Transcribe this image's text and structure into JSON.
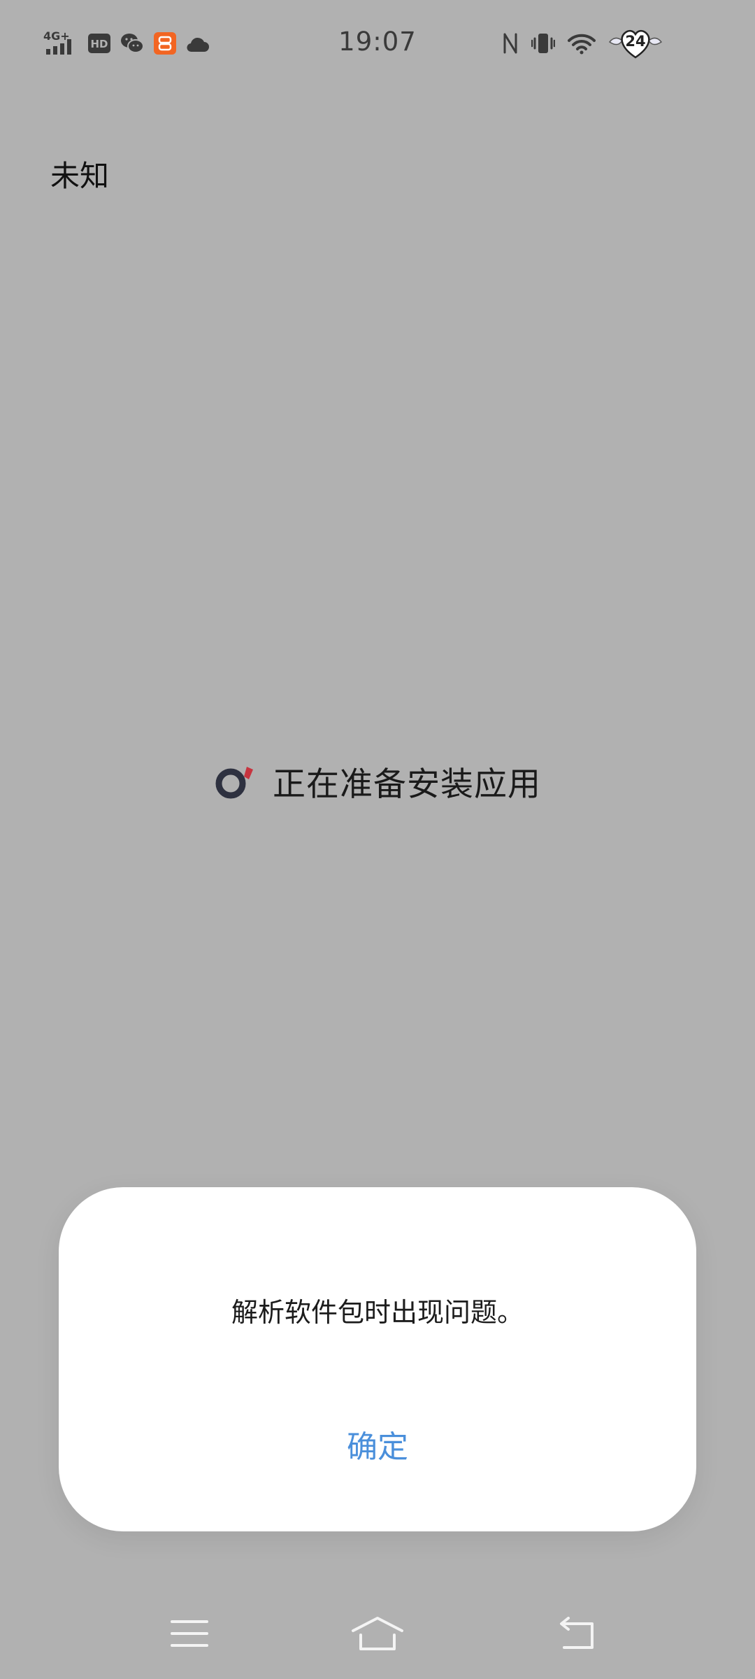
{
  "status_bar": {
    "time": "19:07",
    "network_label": "4G+",
    "hd_label": "HD",
    "badge_count": "24",
    "left_icons": [
      "signal-4g-icon",
      "hd-icon",
      "wechat-icon",
      "app-notification-icon",
      "cloud-icon"
    ],
    "right_icons": [
      "nfc-icon",
      "vibrate-icon",
      "wifi-icon",
      "heart-badge-icon"
    ]
  },
  "app": {
    "name": "未知",
    "progress_text": "正在准备安装应用"
  },
  "dialog": {
    "message": "解析软件包时出现问题。",
    "confirm_label": "确定"
  },
  "nav": {
    "icons": [
      "menu-icon",
      "home-icon",
      "back-icon"
    ]
  },
  "colors": {
    "background": "#b1b1b1",
    "dialog_bg": "#ffffff",
    "accent": "#4a8fdb",
    "spinner_dark": "#2e3140",
    "spinner_red": "#c7343f",
    "notification_orange": "#f26522"
  }
}
